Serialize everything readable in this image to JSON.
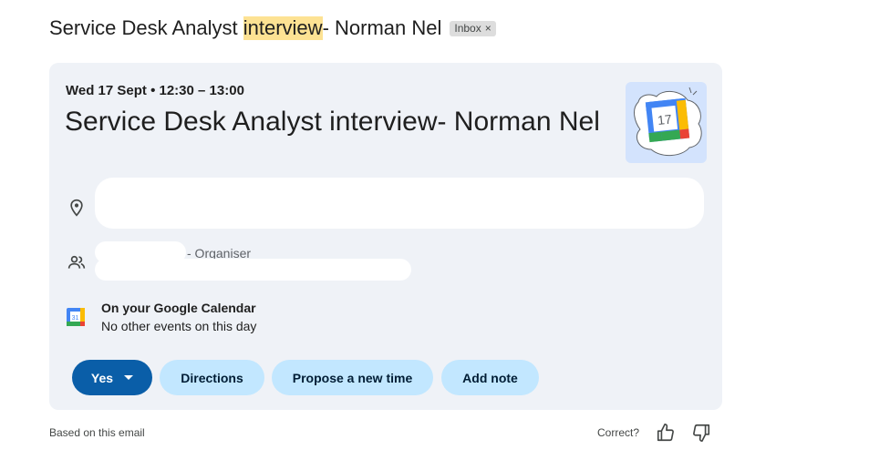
{
  "email": {
    "subject_before": "Service Desk Analyst ",
    "subject_highlight": "interview",
    "subject_after": "- Norman Nel",
    "label_chip": "Inbox",
    "label_chip_close": "×"
  },
  "event": {
    "date_time": "Wed 17 Sept • 12:30 – 13:00",
    "title": "Service Desk Analyst interview- Norman Nel",
    "location_icon": "location-pin-icon",
    "guests_icon": "people-icon",
    "organiser_suffix": "- Organiser",
    "illustration_day": "17"
  },
  "calendar": {
    "heading": "On your Google Calendar",
    "subtext": "No other events on this day",
    "icon_day": "31"
  },
  "actions": {
    "yes": "Yes",
    "directions": "Directions",
    "propose": "Propose a new time",
    "add_note": "Add note"
  },
  "footer": {
    "based_on": "Based on this email",
    "correct": "Correct?",
    "thumbs_up_icon": "thumbs-up-icon",
    "thumbs_down_icon": "thumbs-down-icon"
  },
  "colors": {
    "card_bg": "#eff2f7",
    "primary_button": "#0a5ea8",
    "tonal_button": "#c2e7ff",
    "highlight": "#fde293"
  }
}
